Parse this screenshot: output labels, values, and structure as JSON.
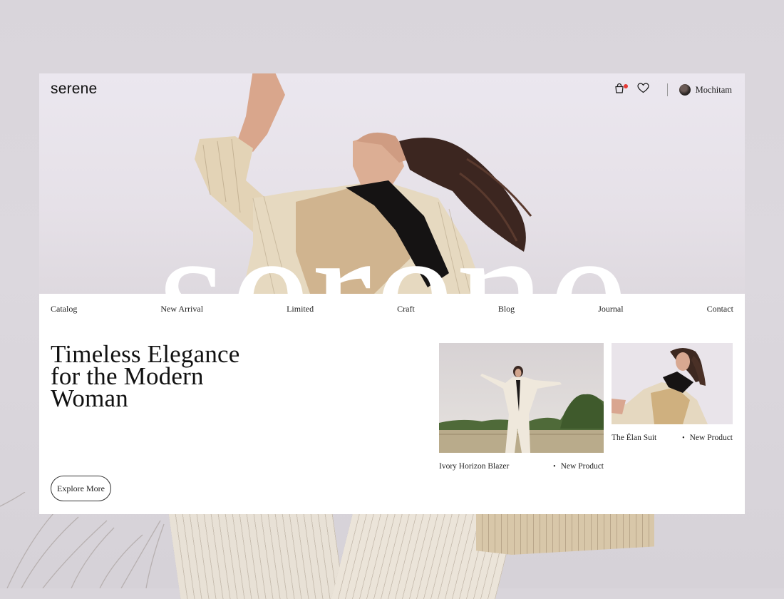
{
  "brand": {
    "logo": "serene",
    "hero_word": "serene"
  },
  "header": {
    "cart_icon": "shopping-bag-icon",
    "wishlist_icon": "heart-icon",
    "user": {
      "name": "Mochitam"
    }
  },
  "nav": {
    "items": [
      "Catalog",
      "New Arrival",
      "Limited",
      "Craft",
      "Blog",
      "Journal",
      "Contact"
    ]
  },
  "hero": {
    "headline": "Timeless Elegance for the Modern Woman",
    "cta": "Explore More"
  },
  "products": [
    {
      "name": "Ivory Horizon Blazer",
      "tag": "New Product"
    },
    {
      "name": "The Élan Suit",
      "tag": "New Product"
    }
  ],
  "colors": {
    "accent_dot": "#e53935",
    "card_bg": "#ffffff",
    "page_bg": "#d9d5db"
  }
}
